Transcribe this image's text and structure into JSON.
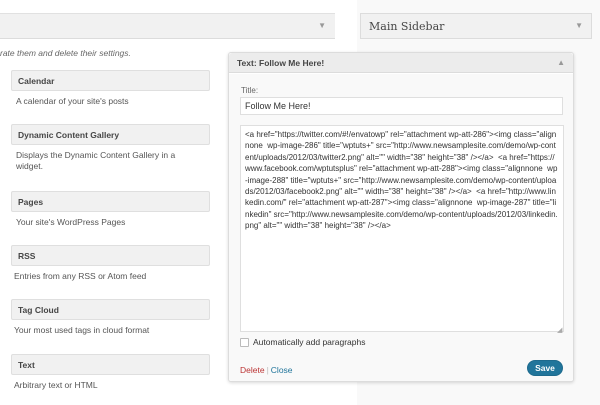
{
  "available_widgets": {
    "instructions": "rate them and delete their settings.",
    "items": [
      {
        "title": "Calendar",
        "description": "A calendar of your site's posts"
      },
      {
        "title": "Dynamic Content Gallery",
        "description": "Displays the Dynamic Content Gallery in a\nwidget."
      },
      {
        "title": "Pages",
        "description": "Your site's WordPress Pages"
      },
      {
        "title": "RSS",
        "description": "Entries from any RSS or Atom feed"
      },
      {
        "title": "Tag Cloud",
        "description": "Your most used tags in cloud format"
      },
      {
        "title": "Text",
        "description": "Arbitrary text or HTML"
      }
    ]
  },
  "sidebar": {
    "title": "Main Sidebar"
  },
  "text_widget": {
    "header_title": "Text: Follow Me Here!",
    "title_label": "Title:",
    "title_value": "Follow Me Here!",
    "content": "<a href=\"https://twitter.com/#!/envatowp\" rel=\"attachment wp-att-286\"><img class=\"alignnone  wp-image-286\" title=\"wptuts+\" src=\"http://www.newsamplesite.com/demo/wp-content/uploads/2012/03/twitter2.png\" alt=\"\" width=\"38\" height=\"38\" /></a>  <a href=\"https://www.facebook.com/wptutsplus\" rel=\"attachment wp-att-288\"><img class=\"alignnone  wp-image-288\" title=\"wptuts+\" src=\"http://www.newsamplesite.com/demo/wp-content/uploads/2012/03/facebook2.png\" alt=\"\" width=\"38\" height=\"38\" /></a>  <a href=\"http://www.linkedin.com/\" rel=\"attachment wp-att-287\"><img class=\"alignnone  wp-image-287\" title=\"linkedin\" src=\"http://www.newsamplesite.com/demo/wp-content/uploads/2012/03/linkedin.png\" alt=\"\" width=\"38\" height=\"38\" /></a>",
    "auto_paragraphs_label": "Automatically add paragraphs",
    "auto_paragraphs_checked": false,
    "delete_label": "Delete",
    "separator": "|",
    "close_label": "Close",
    "save_label": "Save"
  },
  "colors": {
    "accent": "#21759b",
    "delete": "#bc0b0b"
  }
}
